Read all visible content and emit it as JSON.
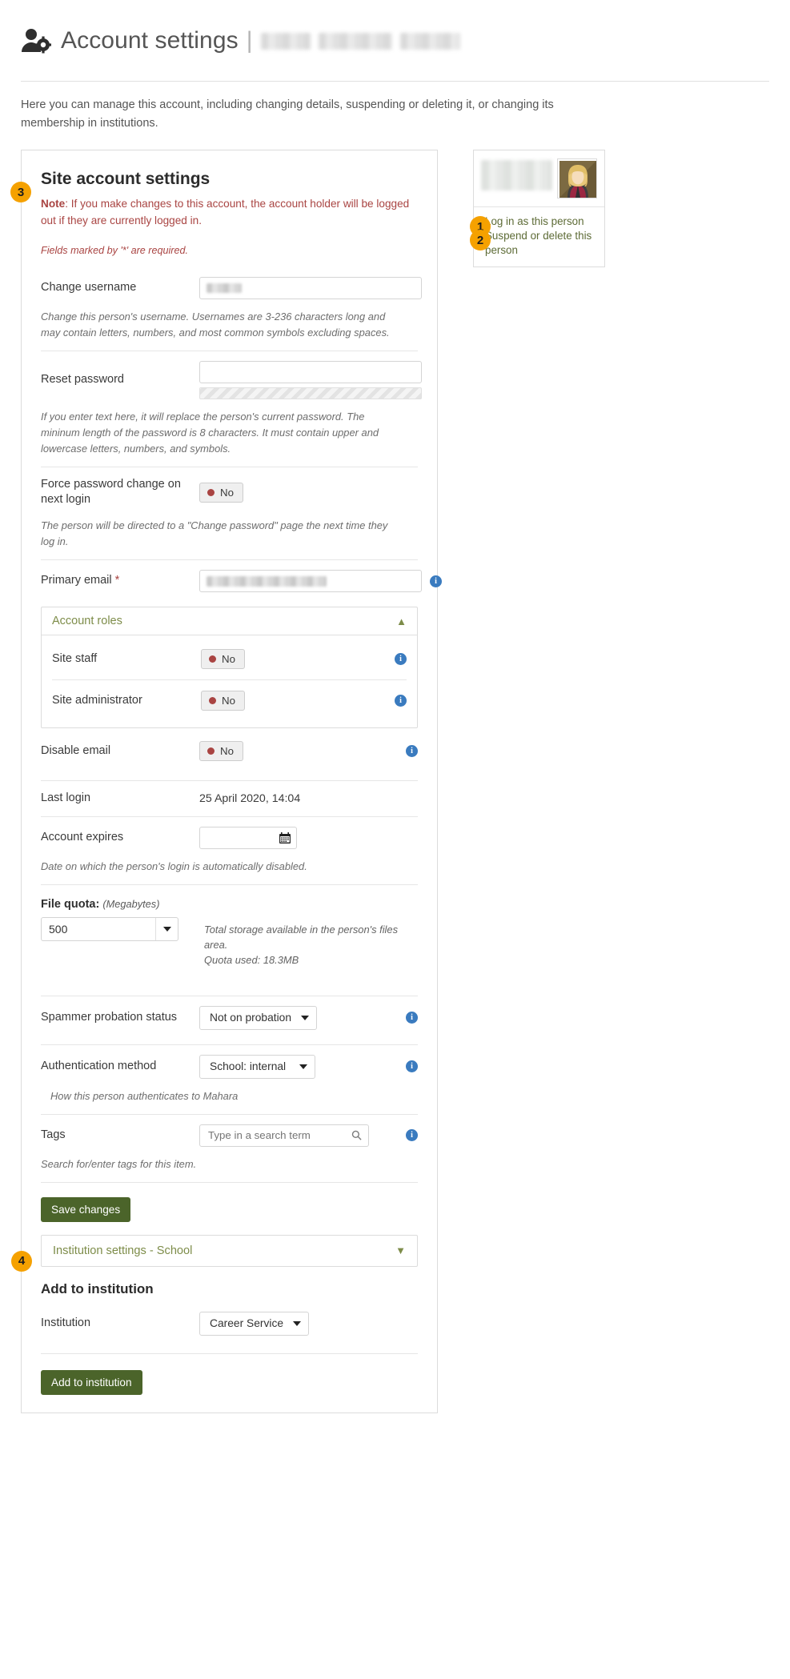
{
  "header": {
    "icon": "user-gear-icon",
    "title": "Account settings",
    "separator": "|",
    "redacted_name": true
  },
  "intro": "Here you can manage this account, including changing details, suspending or deleting it, or changing its membership in institutions.",
  "panel": {
    "badge": "3",
    "title": "Site account settings",
    "note_label": "Note",
    "note_text": ": If you make changes to this account, the account holder will be logged out if they are currently logged in.",
    "required_note": "Fields marked by '*' are required."
  },
  "fields": {
    "username": {
      "label": "Change username",
      "value": "",
      "help": "Change this person's username. Usernames are 3-236 characters long and may contain letters, numbers, and most common symbols excluding spaces."
    },
    "password": {
      "label": "Reset password",
      "value": "",
      "help": "If you enter text here, it will replace the person's current password. The mininum length of the password is 8 characters. It must contain upper and lowercase letters, numbers, and symbols."
    },
    "force_password": {
      "label": "Force password change on next login",
      "value": "No",
      "help": "The person will be directed to a \"Change password\" page the next time they log in."
    },
    "primary_email": {
      "label": "Primary email",
      "required_marker": "*",
      "value": ""
    },
    "account_roles": {
      "title": "Account roles",
      "expanded": true,
      "chevron": "chevron-up-icon",
      "items": [
        {
          "label": "Site staff",
          "value": "No"
        },
        {
          "label": "Site administrator",
          "value": "No"
        }
      ]
    },
    "disable_email": {
      "label": "Disable email",
      "value": "No"
    },
    "last_login": {
      "label": "Last login",
      "value": "25 April 2020, 14:04"
    },
    "account_expires": {
      "label": "Account expires",
      "value": "",
      "icon": "calendar-icon",
      "help": "Date on which the person's login is automatically disabled."
    },
    "file_quota": {
      "label": "File quota:",
      "unit": "(Megabytes)",
      "value": "500",
      "help_line1": "Total storage available in the person's files area.",
      "help_line2": "Quota used: 18.3MB"
    },
    "spammer_probation": {
      "label": "Spammer probation status",
      "value": "Not on probation"
    },
    "auth_method": {
      "label": "Authentication method",
      "value": "School: internal",
      "help": "How this person authenticates to Mahara"
    },
    "tags": {
      "label": "Tags",
      "placeholder": "Type in a search term",
      "value": "",
      "icon": "search-icon",
      "help": "Search for/enter tags for this item."
    }
  },
  "buttons": {
    "save_changes": "Save changes",
    "add_to_institution": "Add to institution"
  },
  "institution_section": {
    "badge": "4",
    "bar_label": "Institution settings - School",
    "chevron": "chevron-down-icon",
    "heading": "Add to institution",
    "institution_label": "Institution",
    "institution_value": "Career Service"
  },
  "sidebar": {
    "avatar": "user-avatar",
    "links": [
      {
        "badge": "1",
        "label": "Log in as this person"
      },
      {
        "badge": "2",
        "label": "Suspend or delete this person"
      }
    ]
  },
  "colors": {
    "accent_green": "#4b642a",
    "badge_orange": "#f5a100",
    "note_red": "#a94442",
    "link_green": "#5d6b36",
    "info_blue": "#3a7bbf"
  }
}
